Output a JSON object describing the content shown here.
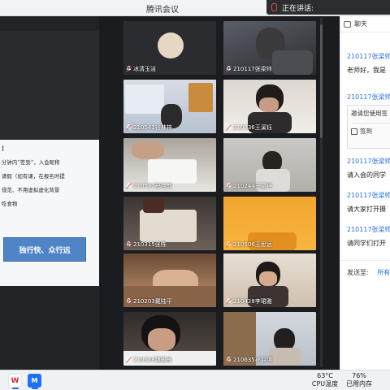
{
  "window": {
    "title": "腾讯会议"
  },
  "speaking": {
    "label": "正在讲话:"
  },
  "slide": {
    "lines": [
      "】",
      "分钟内“签到”，入会昵称",
      "请假（如有课，在报名时提",
      "规范、不用虚拟虚化背景",
      "吃食物"
    ],
    "button_label": "独行快、众行远"
  },
  "participants": [
    {
      "name": "冰清玉洁",
      "scene": "avatar"
    },
    {
      "name": "210117张梁帅",
      "scene": "dark"
    },
    {
      "name": "210541谷林梓",
      "scene": "room-blue"
    },
    {
      "name": "210536王溪钰",
      "scene": "room-white"
    },
    {
      "name": "210537邢佳歆",
      "scene": "desk-white"
    },
    {
      "name": "210244王童锌",
      "scene": "room-grey"
    },
    {
      "name": "210315张陈",
      "scene": "desk-dark"
    },
    {
      "name": "210506王思远",
      "scene": "orange"
    },
    {
      "name": "210203戴陆平",
      "scene": "desk-warm"
    },
    {
      "name": "210428李珺雅",
      "scene": "room-warm"
    },
    {
      "name": "210628魏雅彤",
      "scene": "face-dark"
    },
    {
      "name": "210635孙羽琪",
      "scene": "shelf"
    }
  ],
  "chat": {
    "header": "聊天",
    "messages": [
      {
        "sender": "210117张梁帅",
        "text": "老师好，我是"
      },
      {
        "sender": "210117张梁帅",
        "card_text": "邀请您使用签",
        "card_action": "签到"
      },
      {
        "sender": "210117张梁帅",
        "text": "请入会的同学"
      },
      {
        "sender": "210117张梁帅",
        "text": "请大家打开摄"
      },
      {
        "sender": "210117张梁帅",
        "text": "请同学们打开"
      }
    ],
    "send_to_label": "发送至:",
    "send_to_value": "所有"
  },
  "taskbar": {
    "apps": [
      {
        "name": "wps-app-icon",
        "glyph": "W"
      },
      {
        "name": "tencent-meeting-app-icon",
        "glyph": "M"
      }
    ],
    "cpu_temp": "63°C",
    "cpu_label": "CPU温度",
    "mem_percent": "76%",
    "mem_label": "已用内存"
  },
  "colors": {
    "accent": "#2b6fd6",
    "slide_button": "#4f85c7",
    "dark_bg": "#1b1c1f"
  }
}
